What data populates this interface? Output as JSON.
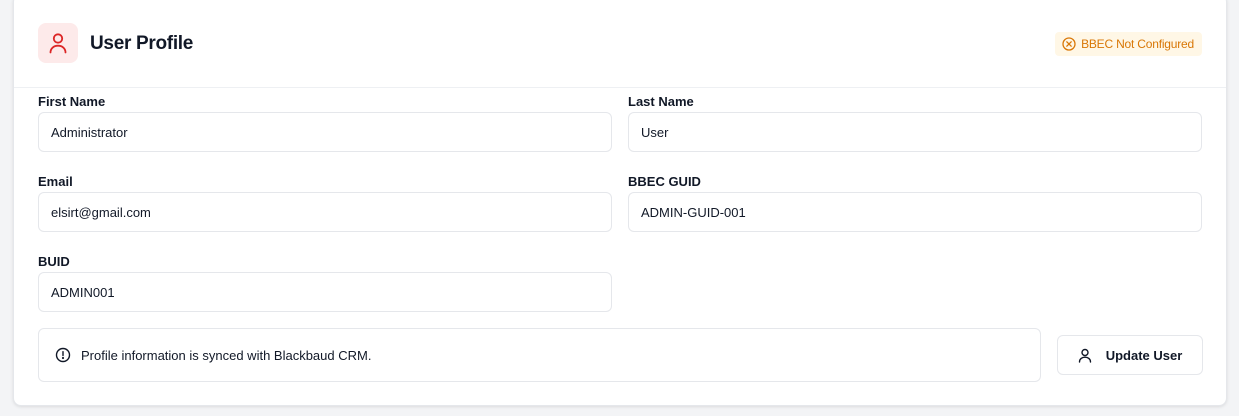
{
  "header": {
    "title": "User Profile",
    "icon": "user-icon",
    "icon_color": "#dc2626",
    "status_badge": {
      "label": "BBEC Not Configured",
      "icon": "x-circle-icon",
      "color": "#d97706"
    }
  },
  "form": {
    "first_name": {
      "label": "First Name",
      "value": "Administrator"
    },
    "last_name": {
      "label": "Last Name",
      "value": "User"
    },
    "email": {
      "label": "Email",
      "value": "elsirt@gmail.com"
    },
    "bbec_guid": {
      "label": "BBEC GUID",
      "value": "ADMIN-GUID-001"
    },
    "buid": {
      "label": "BUID",
      "value": "ADMIN001"
    }
  },
  "info": {
    "icon": "info-circle-icon",
    "text": "Profile information is synced with Blackbaud CRM."
  },
  "actions": {
    "update_label": "Update User",
    "update_icon": "user-icon"
  }
}
